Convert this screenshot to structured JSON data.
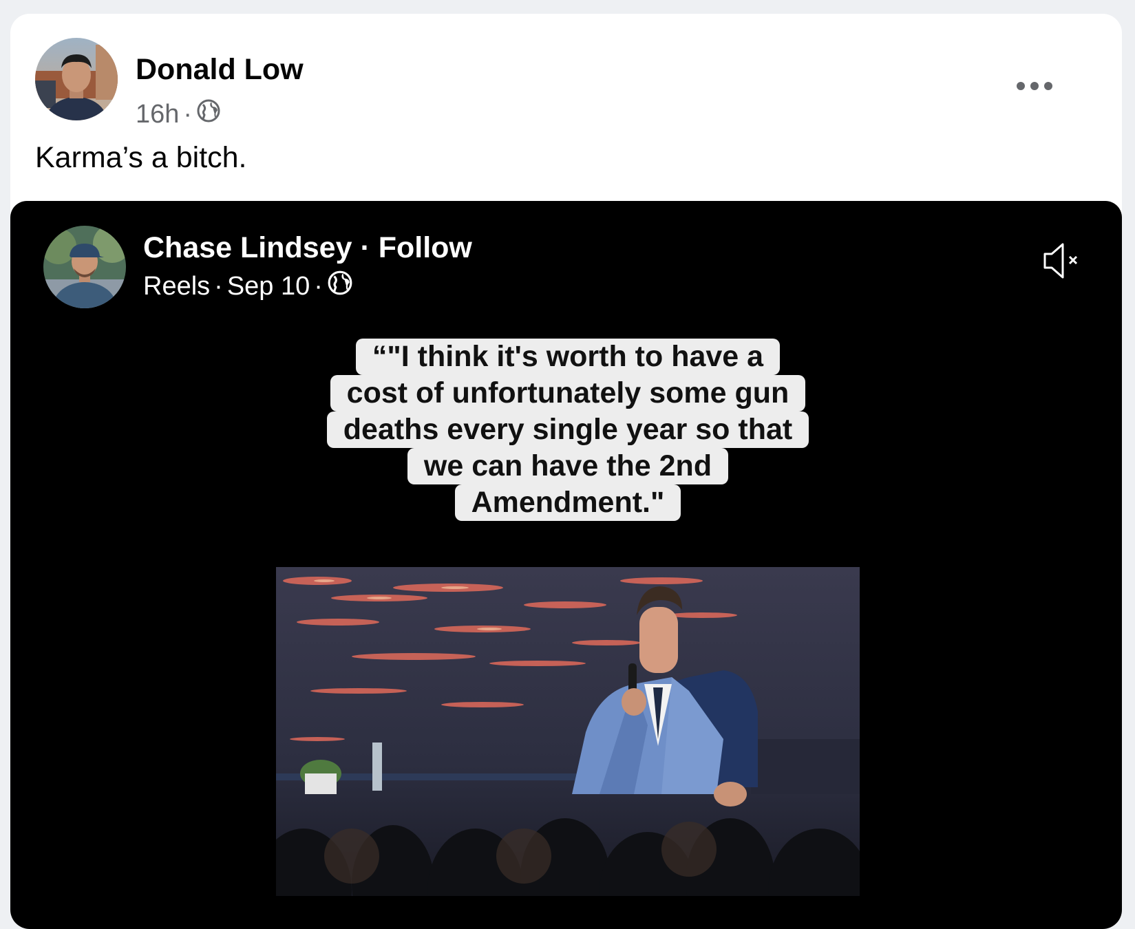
{
  "post": {
    "author": "Donald Low",
    "time": "16h",
    "separator": "·",
    "privacy_icon": "globe-icon",
    "text": "Karma’s a bitch."
  },
  "shared_reel": {
    "author": "Chase Lindsey",
    "separator": "·",
    "follow_label": "Follow",
    "source": "Reels",
    "date": "Sep 10",
    "privacy_icon": "globe-icon",
    "mute_icon": "speaker-muted-icon",
    "caption_lines": [
      "“\"I think it's worth to have a",
      "cost of unfortunately some gun",
      "deaths every single year so that",
      "we can have the 2nd",
      "Amendment.\""
    ]
  },
  "colors": {
    "card_bg": "#ffffff",
    "page_bg": "#eef0f3",
    "secondary_text": "#65676b",
    "embed_bg": "#000000",
    "caption_bg": "#ededed"
  }
}
